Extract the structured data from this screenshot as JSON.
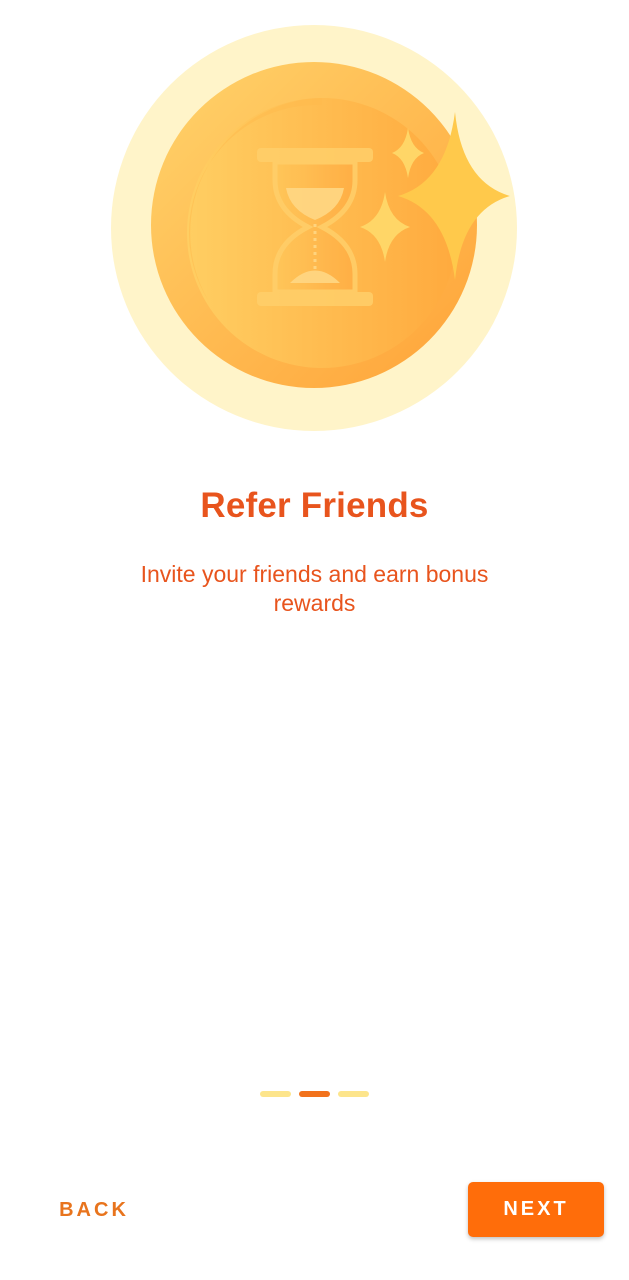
{
  "onboarding": {
    "title": "Refer Friends",
    "description": "Invite your friends and earn bonus rewards",
    "illustration_icon": "hourglass-coin-icon",
    "sparkle_icon": "sparkle-icon"
  },
  "pager": {
    "total_pages": 3,
    "active_page": 2
  },
  "navigation": {
    "back_label": "BACK",
    "next_label": "NEXT"
  },
  "colors": {
    "accent": "#e8541d",
    "button": "#ff6d0a",
    "dot_active": "#f2721c",
    "dot_inactive": "#fde58c"
  }
}
